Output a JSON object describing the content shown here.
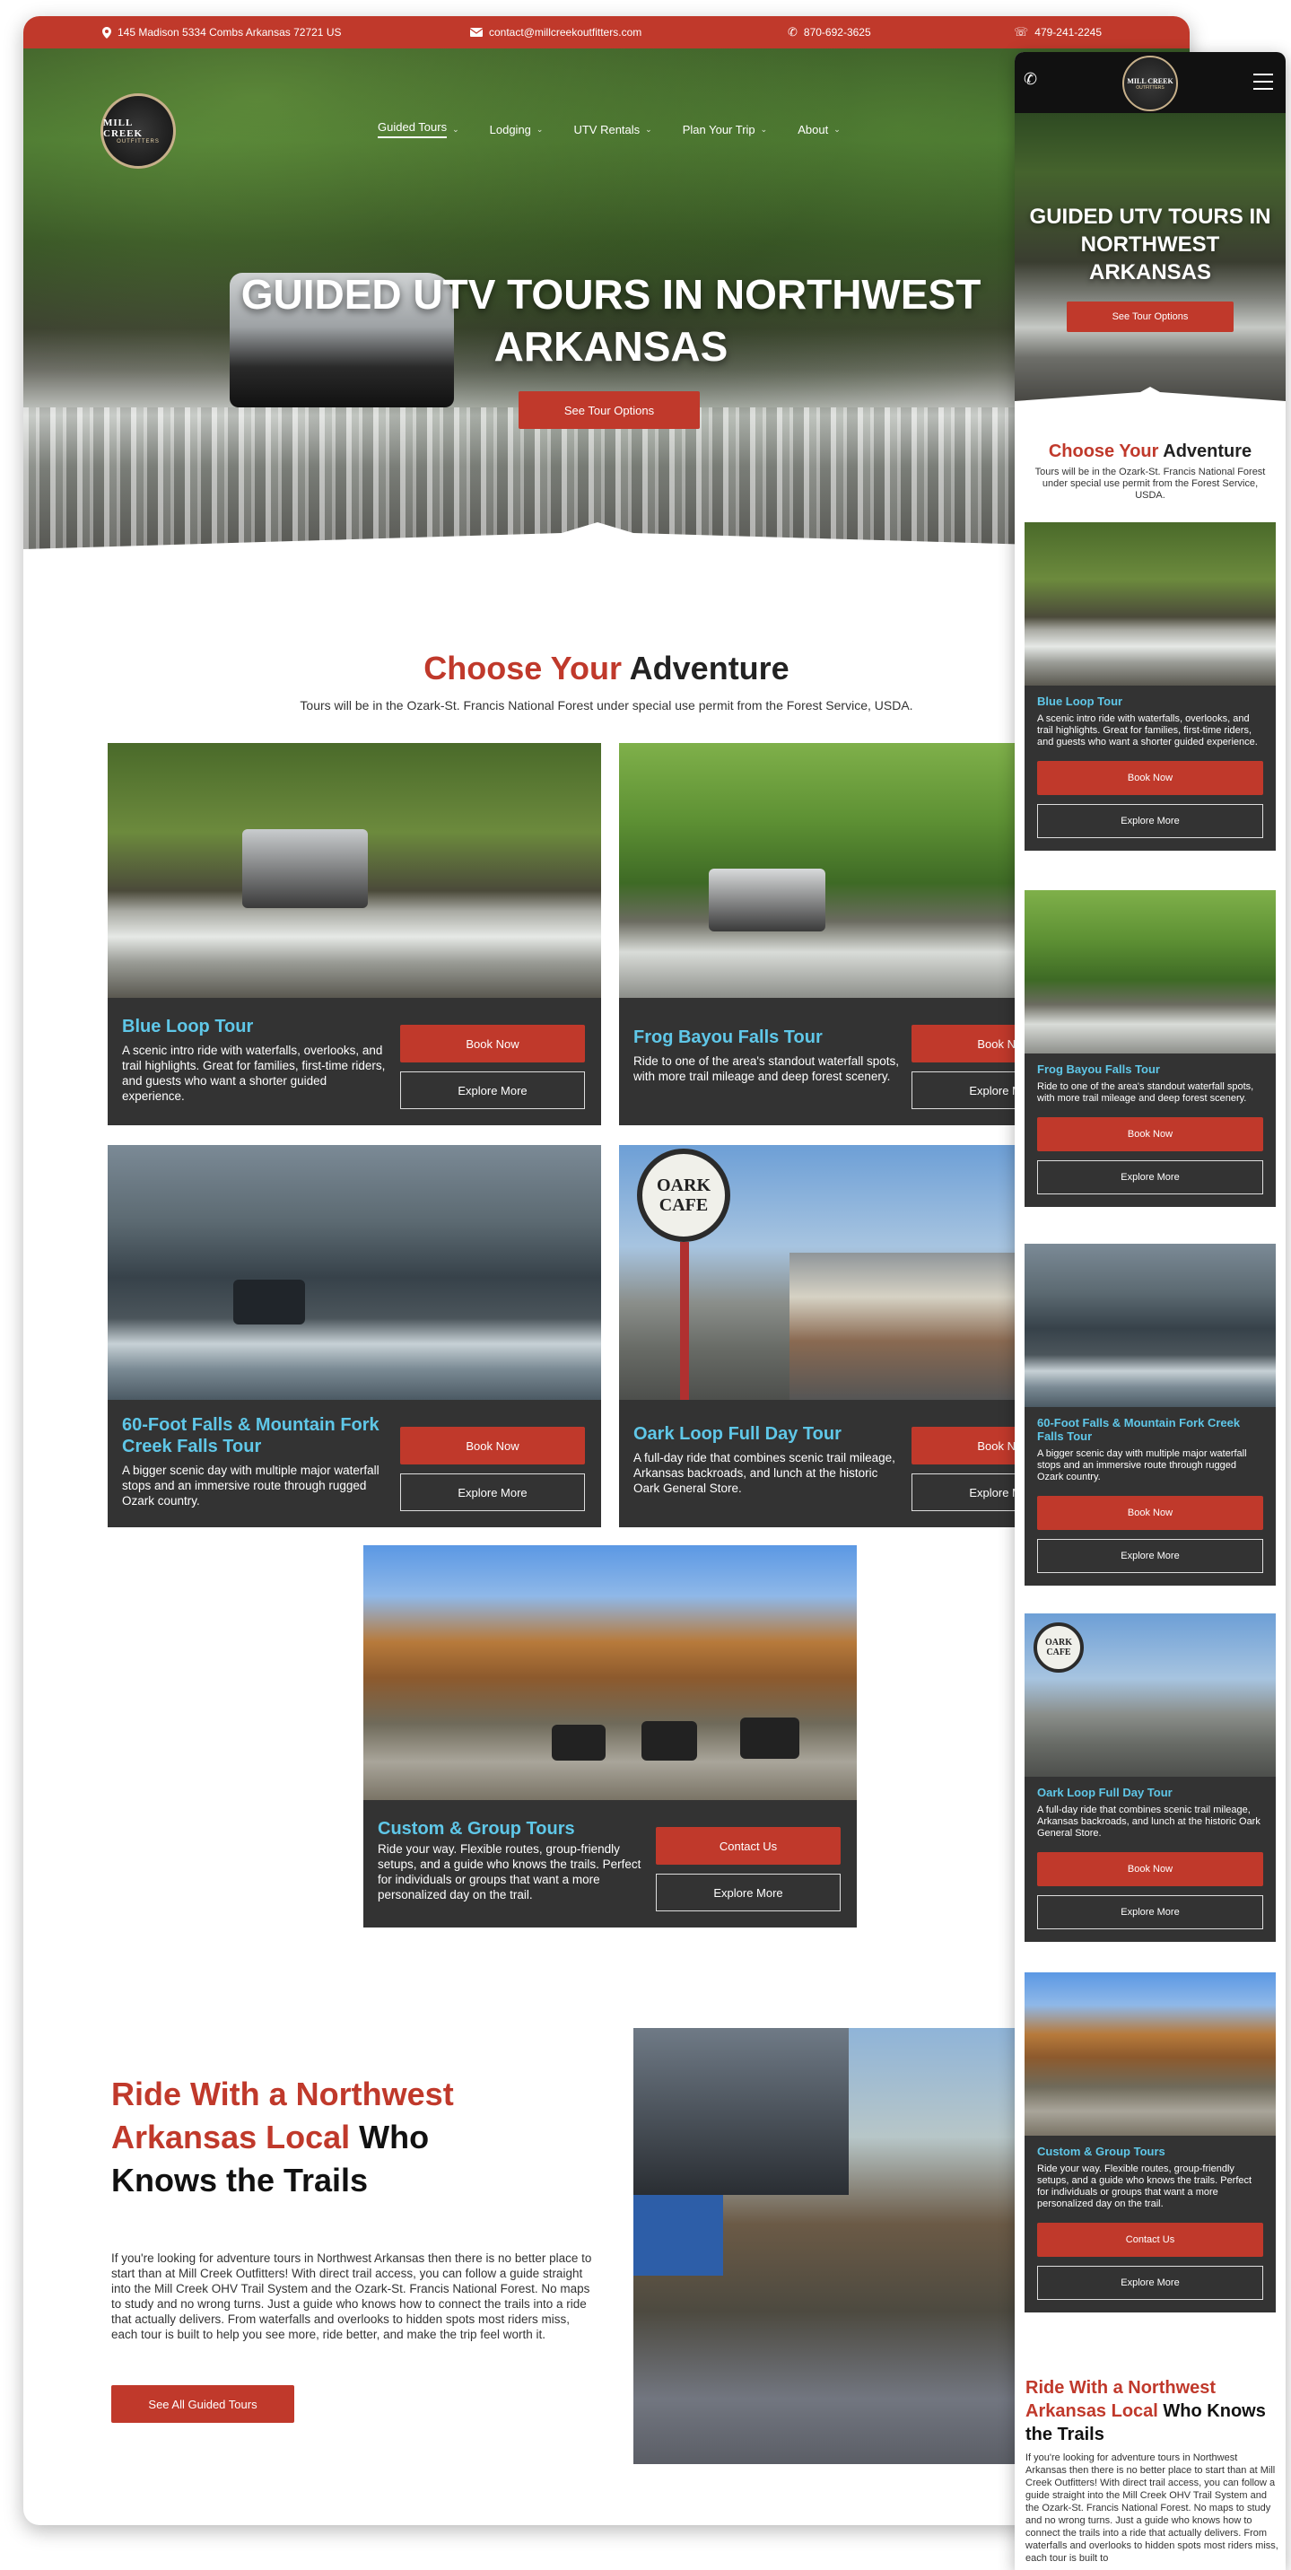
{
  "topbar": {
    "address": "145 Madison 5334 Combs Arkansas 72721 US",
    "email": "contact@millcreekoutfitters.com",
    "phone1": "870-692-3625",
    "phone2": "479-241-2245"
  },
  "logo": {
    "line1": "MILL CREEK",
    "line2": "OUTFITTERS"
  },
  "nav": [
    "Guided Tours",
    "Lodging",
    "UTV Rentals",
    "Plan Your Trip",
    "About"
  ],
  "hero": {
    "title": "GUIDED UTV TOURS IN NORTHWEST ARKANSAS",
    "button": "See Tour Options"
  },
  "adventure": {
    "title_red": "Choose Your",
    "title_black": " Adventure",
    "subtitle": "Tours will be in the Ozark-St. Francis National Forest under special use permit from the Forest Service, USDA."
  },
  "tours": [
    {
      "title": "Blue Loop Tour",
      "desc": "A scenic intro ride with waterfalls, overlooks, and trail highlights. Great for families, first-time riders, and guests who want a shorter guided experience.",
      "primary": "Book Now",
      "secondary": "Explore More"
    },
    {
      "title": "Frog Bayou Falls Tour",
      "desc": "Ride to one of the area's standout waterfall spots, with more trail mileage and deep forest scenery.",
      "primary": "Book Now",
      "secondary": "Explore More"
    },
    {
      "title": "60-Foot Falls & Mountain Fork Creek Falls Tour",
      "desc": "A bigger scenic day with multiple major waterfall stops and an immersive route through rugged Ozark country.",
      "primary": "Book Now",
      "secondary": "Explore More"
    },
    {
      "title": "Oark Loop Full Day Tour",
      "desc": "A full-day ride that combines scenic trail mileage, Arkansas backroads, and lunch at the historic Oark General Store.",
      "primary": "Book Now",
      "secondary": "Explore More"
    },
    {
      "title": "Custom & Group Tours",
      "desc": "Ride your way. Flexible routes, group-friendly setups, and a guide who knows the trails. Perfect for individuals or groups that want a more personalized day on the trail.",
      "primary": "Contact Us",
      "secondary": "Explore More"
    }
  ],
  "local": {
    "title_red": "Ride With a Northwest Arkansas Local",
    "title_black": " Who Knows the Trails",
    "body": "If you're looking for adventure tours in Northwest Arkansas then there is no better place to start than at Mill Creek Outfitters!  With direct trail access, you can follow a guide straight into the Mill Creek OHV Trail System and the Ozark-St. Francis National Forest. No maps to study and no wrong turns. Just a guide who knows how to connect the trails into a ride that actually delivers. From waterfalls and overlooks to hidden spots most riders miss, each tour is built to help you see more, ride better, and make the trip feel worth it.",
    "mobile_body": "If you're looking for adventure tours in Northwest Arkansas then there is no better place to start than at Mill Creek Outfitters!  With direct trail access, you can follow a guide straight into the Mill Creek OHV Trail System and the Ozark-St. Francis National Forest. No maps to study and no wrong turns. Just a guide who knows how to connect the trails into a ride that actually delivers. From waterfalls and overlooks to hidden spots most riders miss, each tour is built to",
    "button": "See All Guided Tours"
  },
  "sign_text": {
    "line1": "OARK",
    "line2": "CAFE"
  },
  "colors": {
    "brand_red": "#c0392b",
    "accent_blue": "#5fc7e8",
    "card_bg": "#333333"
  },
  "icons": [
    "map-pin-icon",
    "mail-icon",
    "phone-icon",
    "fax-icon",
    "chevron-down-icon",
    "hamburger-menu-icon"
  ]
}
